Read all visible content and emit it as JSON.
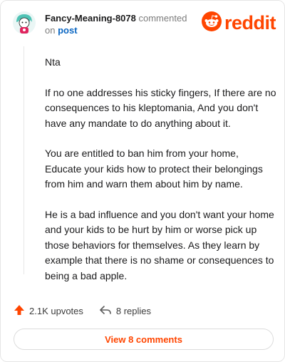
{
  "header": {
    "username": "Fancy-Meaning-8078",
    "action_text": "commented",
    "on_text": "on",
    "post_label": "post",
    "logo_text": "reddit"
  },
  "comment": {
    "paragraphs": [
      "Nta",
      "If no one addresses his sticky fingers, If there are no consequences to his kleptomania, And you don't have any mandate to do anything about it.",
      "You are entitled to ban him from your home, Educate your kids how to protect their belongings from him and warn them about him by name.",
      "He is a bad influence and you don't want your home and your kids to be hurt by him or worse pick up those behaviors for themselves. As they learn by example that there is no shame or consequences to being a bad apple."
    ]
  },
  "footer": {
    "upvotes_label": "2.1K upvotes",
    "replies_label": "8 replies",
    "view_comments_label": "View 8 comments"
  },
  "colors": {
    "brand": "#ff4500",
    "link": "#0a66c2",
    "muted": "#7c7c7c"
  },
  "icons": [
    "avatar",
    "reddit-snoo-icon",
    "upvote-arrow-icon",
    "reply-arrow-icon"
  ]
}
